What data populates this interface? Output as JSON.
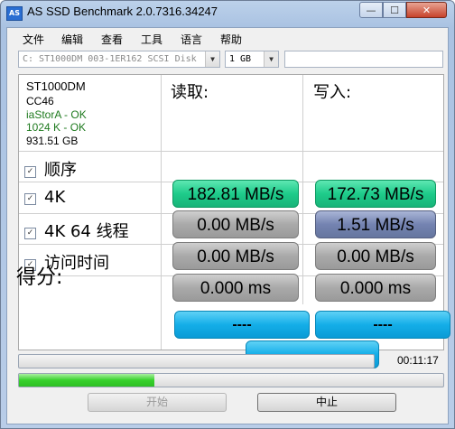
{
  "window": {
    "title": "AS SSD Benchmark 2.0.7316.34247",
    "icon": "AS",
    "min_glyph": "—",
    "max_glyph": "☐",
    "close_glyph": "✕"
  },
  "menu": {
    "items": [
      "文件",
      "编辑",
      "查看",
      "工具",
      "语言",
      "帮助"
    ]
  },
  "toolbar": {
    "disk": "C: ST1000DM 003-1ER162 SCSI Disk",
    "size": "1 GB",
    "arrow": "▼",
    "extra": ""
  },
  "drive": {
    "name": "ST1000DM",
    "firmware": "CC46",
    "driver": "iaStorA - OK",
    "alignment": "1024 K - OK",
    "capacity": "931.51 GB"
  },
  "columns": {
    "read": "读取:",
    "write": "写入:"
  },
  "checkmark": "✓",
  "rows": [
    {
      "label": "顺序",
      "checked": true,
      "read": "182.81 MB/s",
      "write": "172.73 MB/s"
    },
    {
      "label": "4K",
      "checked": true,
      "read": "0.00 MB/s",
      "write": "1.51 MB/s"
    },
    {
      "label": "4K 64 线程",
      "checked": true,
      "read": "0.00 MB/s",
      "write": "0.00 MB/s"
    },
    {
      "label": "访问时间",
      "checked": true,
      "read": "0.000 ms",
      "write": "0.000 ms"
    }
  ],
  "score": {
    "label": "得分:",
    "read": "----",
    "write": "----",
    "total": "----"
  },
  "progress": {
    "overall": 0,
    "current": 0.32,
    "elapsed": "00:11:17"
  },
  "buttons": {
    "start": "开始",
    "stop": "中止"
  },
  "colors": {
    "green": "#1ecb8a",
    "gray": "#a9a9a9",
    "blue": "#7483b1",
    "score": "#14aee8",
    "ok_text": "#1e7a1e"
  }
}
